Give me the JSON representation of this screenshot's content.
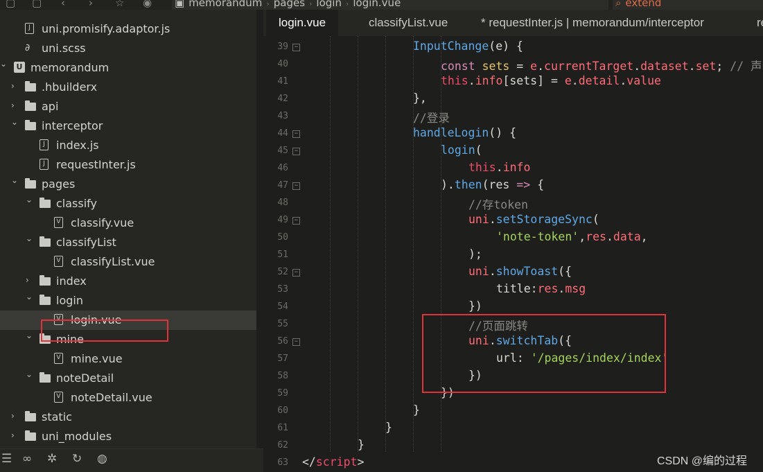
{
  "breadcrumb": [
    "memorandum",
    "pages",
    "login",
    "login.vue"
  ],
  "search": {
    "value": "extend"
  },
  "tabs": [
    {
      "label": "login.vue",
      "active": true
    },
    {
      "label": "classifyList.vue",
      "active": false
    },
    {
      "label": "* requestInter.js | memorandum/interceptor",
      "active": false
    },
    {
      "label": "re",
      "active": false
    }
  ],
  "tree": [
    {
      "label": "uni.promisify.adaptor.js",
      "kind": "file-js"
    },
    {
      "label": "uni.scss",
      "kind": "file-scss"
    },
    {
      "label": "memorandum",
      "kind": "project"
    },
    {
      "label": ".hbuilderx",
      "kind": "folder"
    },
    {
      "label": "api",
      "kind": "folder"
    },
    {
      "label": "interceptor",
      "kind": "folder"
    },
    {
      "label": "index.js",
      "kind": "file-js"
    },
    {
      "label": "requestInter.js",
      "kind": "file-js"
    },
    {
      "label": "pages",
      "kind": "folder"
    },
    {
      "label": "classify",
      "kind": "folder"
    },
    {
      "label": "classify.vue",
      "kind": "file-vue"
    },
    {
      "label": "classifyList",
      "kind": "folder"
    },
    {
      "label": "classifyList.vue",
      "kind": "file-vue"
    },
    {
      "label": "index",
      "kind": "folder"
    },
    {
      "label": "login",
      "kind": "folder"
    },
    {
      "label": "login.vue",
      "kind": "file-vue",
      "selected": true
    },
    {
      "label": "mine",
      "kind": "folder"
    },
    {
      "label": "mine.vue",
      "kind": "file-vue"
    },
    {
      "label": "noteDetail",
      "kind": "folder"
    },
    {
      "label": "noteDetail.vue",
      "kind": "file-vue"
    },
    {
      "label": "static",
      "kind": "folder"
    },
    {
      "label": "uni_modules",
      "kind": "folder"
    }
  ],
  "line_numbers": [
    "39",
    "40",
    "41",
    "42",
    "43",
    "44",
    "45",
    "46",
    "47",
    "48",
    "49",
    "50",
    "51",
    "52",
    "53",
    "54",
    "55",
    "56",
    "57",
    "58",
    "59",
    "60",
    "61",
    "62",
    "63"
  ],
  "code_lines": [
    [
      {
        "t": "InputChange",
        "c": "fn"
      },
      {
        "t": "(e) {",
        "c": "punc"
      }
    ],
    [
      {
        "t": "const ",
        "c": "kw"
      },
      {
        "t": "sets",
        "c": "var"
      },
      {
        "t": " = ",
        "c": "punc"
      },
      {
        "t": "e",
        "c": "prop"
      },
      {
        "t": ".",
        "c": "punc"
      },
      {
        "t": "currentTarget",
        "c": "prop"
      },
      {
        "t": ".",
        "c": "punc"
      },
      {
        "t": "dataset",
        "c": "prop"
      },
      {
        "t": ".",
        "c": "punc"
      },
      {
        "t": "set",
        "c": "prop"
      },
      {
        "t": "; ",
        "c": "punc"
      },
      {
        "t": "// 声明一",
        "c": "cmt"
      }
    ],
    [
      {
        "t": "this",
        "c": "this"
      },
      {
        "t": ".",
        "c": "punc"
      },
      {
        "t": "info",
        "c": "prop"
      },
      {
        "t": "[sets] = ",
        "c": "punc"
      },
      {
        "t": "e",
        "c": "prop"
      },
      {
        "t": ".",
        "c": "punc"
      },
      {
        "t": "detail",
        "c": "prop"
      },
      {
        "t": ".",
        "c": "punc"
      },
      {
        "t": "value",
        "c": "prop"
      }
    ],
    [
      {
        "t": "},",
        "c": "punc"
      }
    ],
    [
      {
        "t": "//登录",
        "c": "cmt"
      }
    ],
    [
      {
        "t": "handleLogin",
        "c": "fn"
      },
      {
        "t": "() {",
        "c": "punc"
      }
    ],
    [
      {
        "t": "login",
        "c": "fn"
      },
      {
        "t": "(",
        "c": "punc"
      }
    ],
    [
      {
        "t": "this",
        "c": "this"
      },
      {
        "t": ".",
        "c": "punc"
      },
      {
        "t": "info",
        "c": "prop"
      }
    ],
    [
      {
        "t": ").",
        "c": "punc"
      },
      {
        "t": "then",
        "c": "fn"
      },
      {
        "t": "(res ",
        "c": "punc"
      },
      {
        "t": "=>",
        "c": "kw"
      },
      {
        "t": " {",
        "c": "punc"
      }
    ],
    [
      {
        "t": "//存token",
        "c": "cmt"
      }
    ],
    [
      {
        "t": "uni",
        "c": "prop"
      },
      {
        "t": ".",
        "c": "punc"
      },
      {
        "t": "setStorageSync",
        "c": "fn"
      },
      {
        "t": "(",
        "c": "punc"
      }
    ],
    [
      {
        "t": "'note-token'",
        "c": "str"
      },
      {
        "t": ",",
        "c": "punc"
      },
      {
        "t": "res",
        "c": "prop"
      },
      {
        "t": ".",
        "c": "punc"
      },
      {
        "t": "data",
        "c": "prop"
      },
      {
        "t": ",",
        "c": "punc"
      }
    ],
    [
      {
        "t": ");",
        "c": "punc"
      }
    ],
    [
      {
        "t": "uni",
        "c": "prop"
      },
      {
        "t": ".",
        "c": "punc"
      },
      {
        "t": "showToast",
        "c": "fn"
      },
      {
        "t": "({",
        "c": "punc"
      }
    ],
    [
      {
        "t": "title:",
        "c": "punc"
      },
      {
        "t": "res",
        "c": "prop"
      },
      {
        "t": ".",
        "c": "punc"
      },
      {
        "t": "msg",
        "c": "prop"
      }
    ],
    [
      {
        "t": "})",
        "c": "punc"
      }
    ],
    [
      {
        "t": "//页面跳转",
        "c": "cmt"
      }
    ],
    [
      {
        "t": "uni",
        "c": "prop"
      },
      {
        "t": ".",
        "c": "punc"
      },
      {
        "t": "switchTab",
        "c": "fn"
      },
      {
        "t": "({",
        "c": "punc"
      }
    ],
    [
      {
        "t": "url",
        "c": "punc"
      },
      {
        "t": ": ",
        "c": "punc"
      },
      {
        "t": "'/pages/index/index'",
        "c": "str"
      }
    ],
    [
      {
        "t": "})",
        "c": "punc"
      }
    ],
    [
      {
        "t": "})",
        "c": "punc"
      }
    ],
    [
      {
        "t": "}",
        "c": "punc"
      }
    ],
    [
      {
        "t": "}",
        "c": "punc"
      }
    ],
    [
      {
        "t": "}",
        "c": "punc"
      }
    ],
    [
      {
        "t": "</",
        "c": "punc"
      },
      {
        "t": "script",
        "c": "this"
      },
      {
        "t": ">",
        "c": "punc"
      }
    ]
  ],
  "watermark": "CSDN @编的过程",
  "colors": {
    "highlight_box": "#e0333b",
    "editor_bg": "#1e1f1c",
    "sidebar_bg": "#262723"
  }
}
